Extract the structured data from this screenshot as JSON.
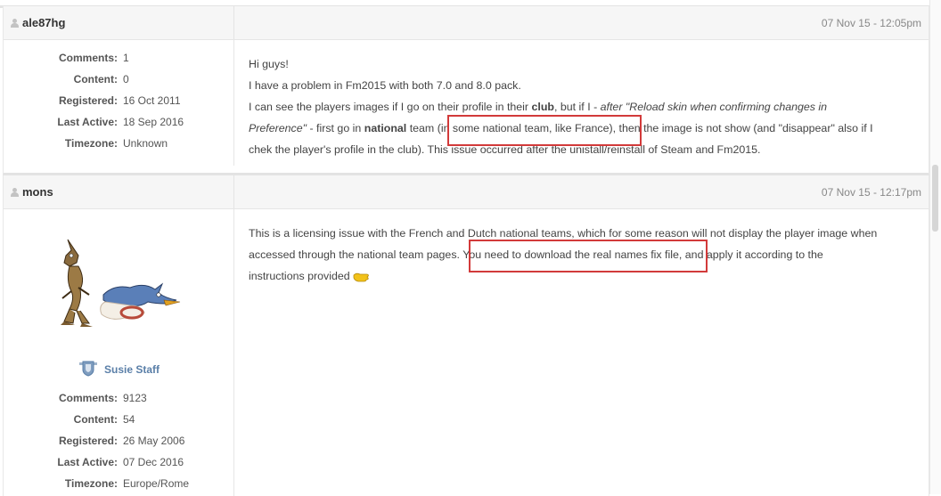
{
  "posts": [
    {
      "username": "ale87hg",
      "date": "07 Nov 15 - 12:05pm",
      "stats": [
        {
          "label": "Comments:",
          "value": "1"
        },
        {
          "label": "Content:",
          "value": "0"
        },
        {
          "label": "Registered:",
          "value": "16 Oct 2011"
        },
        {
          "label": "Last Active:",
          "value": "18 Sep 2016"
        },
        {
          "label": "Timezone:",
          "value": "Unknown"
        }
      ],
      "body": {
        "greeting": "Hi guys!",
        "line2": "I have a problem in Fm2015 with both 7.0 and 8.0 pack.",
        "l3_a": "I can see the players images if I go on their profile in their ",
        "l3_club": "club",
        "l3_b": ", but if I - ",
        "l3_italic": "after \"Reload skin when confirming changes in",
        "l4_italic": "Preference\"",
        "l4_a": " - first go in ",
        "l4_national": "national",
        "l4_b": " team ",
        "l4_box": "(in some national team, like France)",
        "l4_c": ", then the image is not show (and \"disappear\" also if I",
        "line5": "chek the player's profile in the club). This issue occurred after the unistall/reinstall of Steam and Fm2015."
      }
    },
    {
      "username": "mons",
      "date": "07 Nov 15 - 12:17pm",
      "badge": "Susie Staff",
      "stats": [
        {
          "label": "Comments:",
          "value": "9123"
        },
        {
          "label": "Content:",
          "value": "54"
        },
        {
          "label": "Registered:",
          "value": "26 May 2006"
        },
        {
          "label": "Last Active:",
          "value": "07 Dec 2016"
        },
        {
          "label": "Timezone:",
          "value": "Europe/Rome"
        }
      ],
      "body": {
        "line1": "This is a licensing issue with the French and Dutch national teams, which for some reason will not display the player image when",
        "l2_a": "accessed through the national team pages. ",
        "l2_box": "You need to download the real names fix file,",
        "l2_b": " and apply it according to the",
        "line3": "instructions provided "
      }
    }
  ],
  "icons": {
    "user": "user-icon",
    "emoji": "thumbs-up-emoji",
    "avatar": "coyote-roadrunner-avatar",
    "badge": "staff-shield-icon"
  },
  "colors": {
    "highlight_box": "#d23a3a",
    "badge_text": "#5a7fa8"
  }
}
